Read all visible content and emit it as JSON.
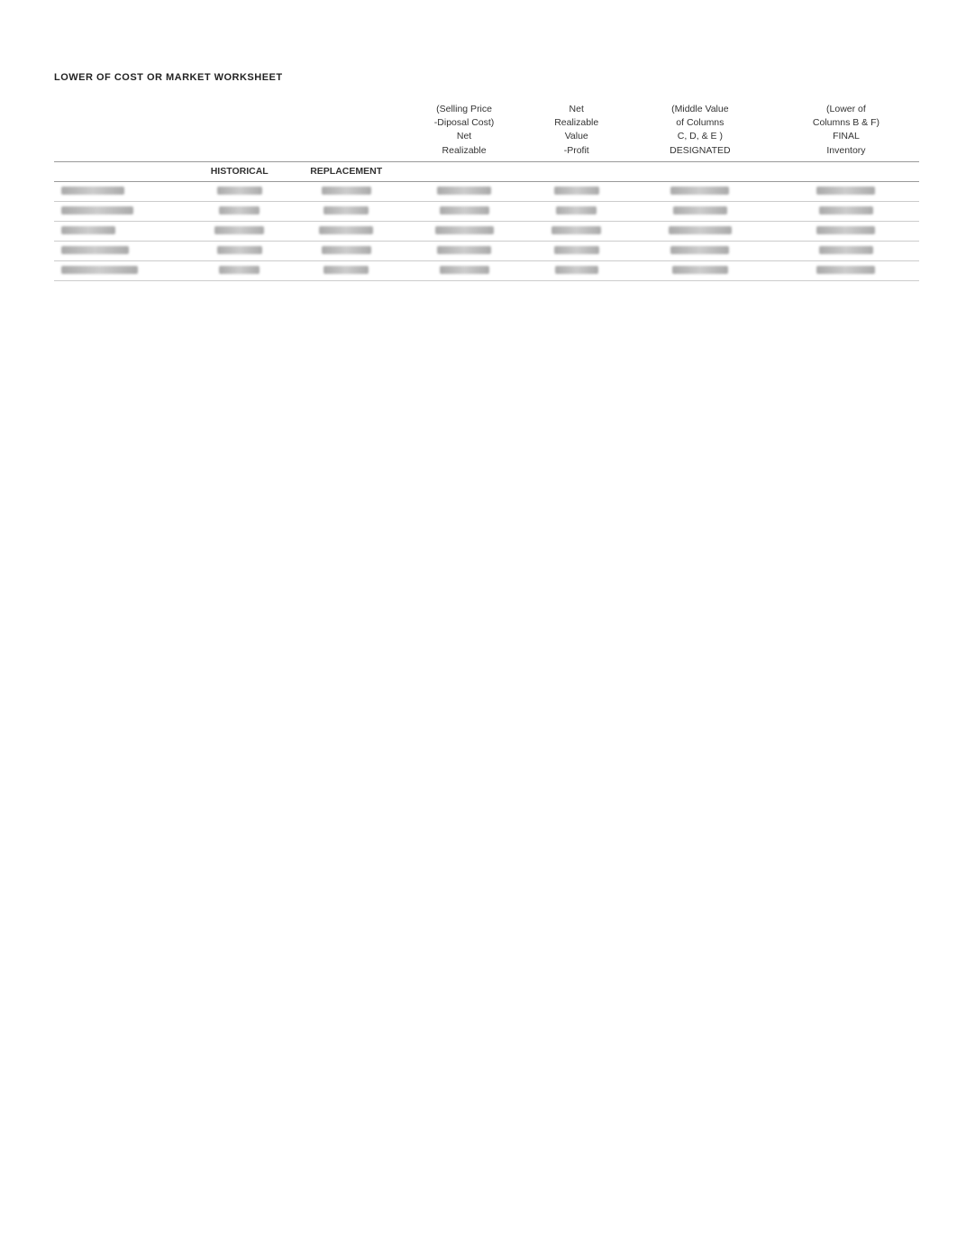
{
  "page": {
    "title": "LOWER OF COST OR MARKET WORKSHEET",
    "columns": [
      {
        "id": "item",
        "header_line1": "",
        "header_line2": "",
        "header_line3": "",
        "header_line4": "",
        "subheader": ""
      },
      {
        "id": "historical",
        "header_line1": "",
        "header_line2": "",
        "header_line3": "",
        "header_line4": "",
        "subheader": "HISTORICAL"
      },
      {
        "id": "replacement",
        "header_line1": "",
        "header_line2": "",
        "header_line3": "",
        "header_line4": "",
        "subheader": "REPLACEMENT"
      },
      {
        "id": "selling",
        "header_line1": "(Selling Price",
        "header_line2": "-Diposal Cost)",
        "header_line3": "Net",
        "header_line4": "Realizable",
        "subheader": ""
      },
      {
        "id": "net",
        "header_line1": "Net",
        "header_line2": "Realizable",
        "header_line3": "Value",
        "header_line4": "-Profit",
        "subheader": ""
      },
      {
        "id": "middle",
        "header_line1": "(Middle Value",
        "header_line2": "of Columns",
        "header_line3": "C, D, & E )",
        "header_line4": "DESIGNATED",
        "subheader": ""
      },
      {
        "id": "lower",
        "header_line1": "(Lower of",
        "header_line2": "Columns B & F)",
        "header_line3": "FINAL",
        "header_line4": "Inventory",
        "subheader": ""
      }
    ],
    "data_rows": [
      {
        "blurred": true,
        "sizes": [
          70,
          50,
          55,
          60,
          50,
          65,
          65
        ]
      },
      {
        "blurred": true,
        "sizes": [
          80,
          45,
          50,
          55,
          45,
          60,
          60
        ]
      },
      {
        "blurred": true,
        "sizes": [
          60,
          55,
          60,
          65,
          55,
          70,
          65
        ]
      },
      {
        "blurred": true,
        "sizes": [
          75,
          50,
          55,
          60,
          50,
          65,
          60
        ]
      },
      {
        "blurred": true,
        "sizes": [
          85,
          45,
          50,
          55,
          48,
          62,
          65
        ]
      }
    ]
  }
}
